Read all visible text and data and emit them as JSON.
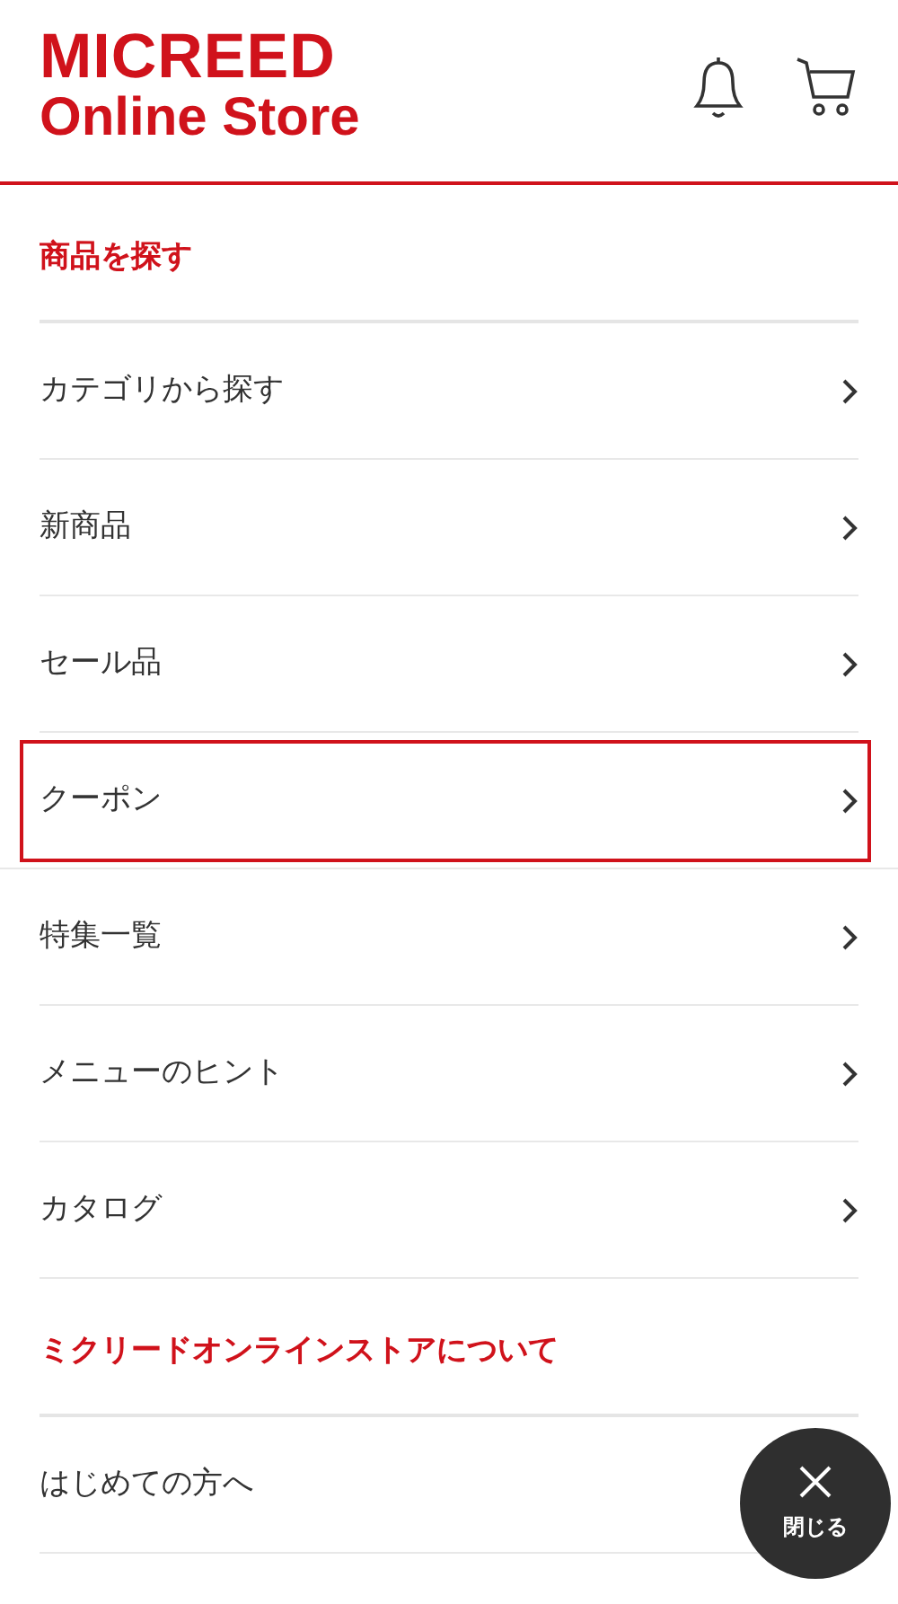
{
  "header": {
    "logo": {
      "line_1": "MICREED",
      "line_2": "Online Store"
    }
  },
  "sections": [
    {
      "title": "商品を探す",
      "items": [
        {
          "label": "カテゴリから探す",
          "highlighted": false
        },
        {
          "label": "新商品",
          "highlighted": false
        },
        {
          "label": "セール品",
          "highlighted": false
        },
        {
          "label": "クーポン",
          "highlighted": true
        },
        {
          "label": "特集一覧",
          "highlighted": false
        },
        {
          "label": "メニューのヒント",
          "highlighted": false
        },
        {
          "label": "カタログ",
          "highlighted": false
        }
      ]
    },
    {
      "title": "ミクリードオンラインストアについて",
      "items": [
        {
          "label": "はじめての方へ",
          "highlighted": false,
          "chevron": false
        }
      ]
    }
  ],
  "close_button": {
    "label": "閉じる"
  }
}
